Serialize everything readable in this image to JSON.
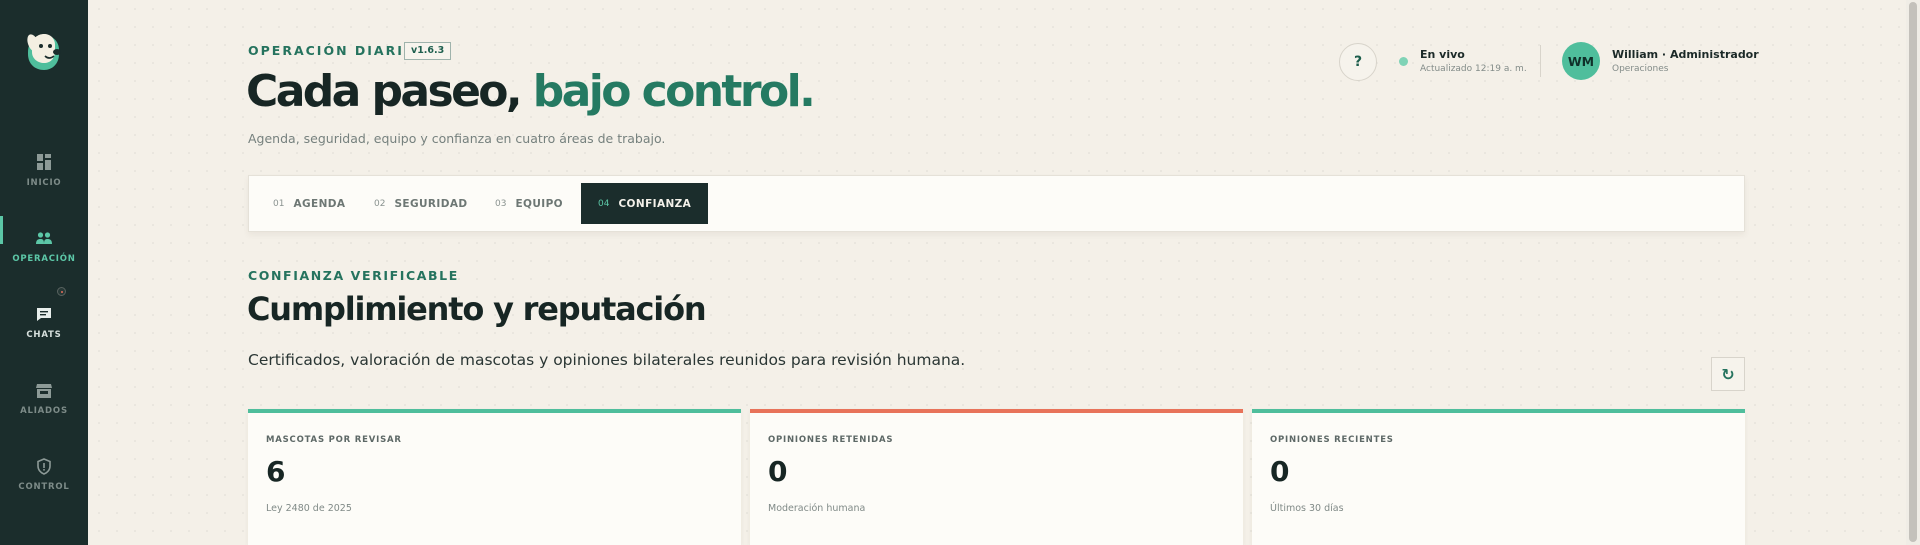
{
  "sidebar": {
    "logo": "dog-logo",
    "items": [
      {
        "label": "INICIO",
        "icon": "dashboard-icon"
      },
      {
        "label": "OPERACIÓN",
        "icon": "people-icon"
      },
      {
        "label": "CHATS",
        "icon": "chat-icon"
      },
      {
        "label": "ALIADOS",
        "icon": "store-icon"
      },
      {
        "label": "CONTROL",
        "icon": "shield-icon"
      }
    ],
    "active": "OPERACIÓN"
  },
  "header": {
    "eyebrow": "OPERACIÓN DIARIA",
    "version": "v1.6.3",
    "title_main": "Cada paseo,",
    "title_accent": "bajo control.",
    "subtitle": "Agenda, seguridad, equipo y confianza en cuatro áreas de trabajo.",
    "help_label": "?",
    "status_label": "En vivo",
    "status_updated": "Actualizado 12:19 a. m.",
    "user_initials": "WM",
    "user_name": "William · Administrador",
    "user_role": "Operaciones"
  },
  "tabs": [
    {
      "num": "01",
      "label": "AGENDA"
    },
    {
      "num": "02",
      "label": "SEGURIDAD"
    },
    {
      "num": "03",
      "label": "EQUIPO"
    },
    {
      "num": "04",
      "label": "CONFIANZA"
    }
  ],
  "active_tab": "CONFIANZA",
  "section": {
    "eyebrow": "CONFIANZA VERIFICABLE",
    "title": "Cumplimiento y reputación",
    "description": "Certificados, valoración de mascotas y opiniones bilaterales reunidos para revisión humana.",
    "refresh_icon": "↻"
  },
  "stats": [
    {
      "label": "MASCOTAS POR REVISAR",
      "value": "6",
      "note": "Ley 2480 de 2025",
      "color": "#4fbe9c"
    },
    {
      "label": "OPINIONES RETENIDAS",
      "value": "0",
      "note": "Moderación humana",
      "color": "#e8735a"
    },
    {
      "label": "OPINIONES RECIENTES",
      "value": "0",
      "note": "Últimos 30 días",
      "color": "#4fbe9c"
    }
  ],
  "colors": {
    "sidebar_bg": "#1b2d2c",
    "accent_green": "#25735e",
    "mint": "#4fbe9c",
    "coral": "#e8735a",
    "page_bg": "#f4f0e8"
  }
}
